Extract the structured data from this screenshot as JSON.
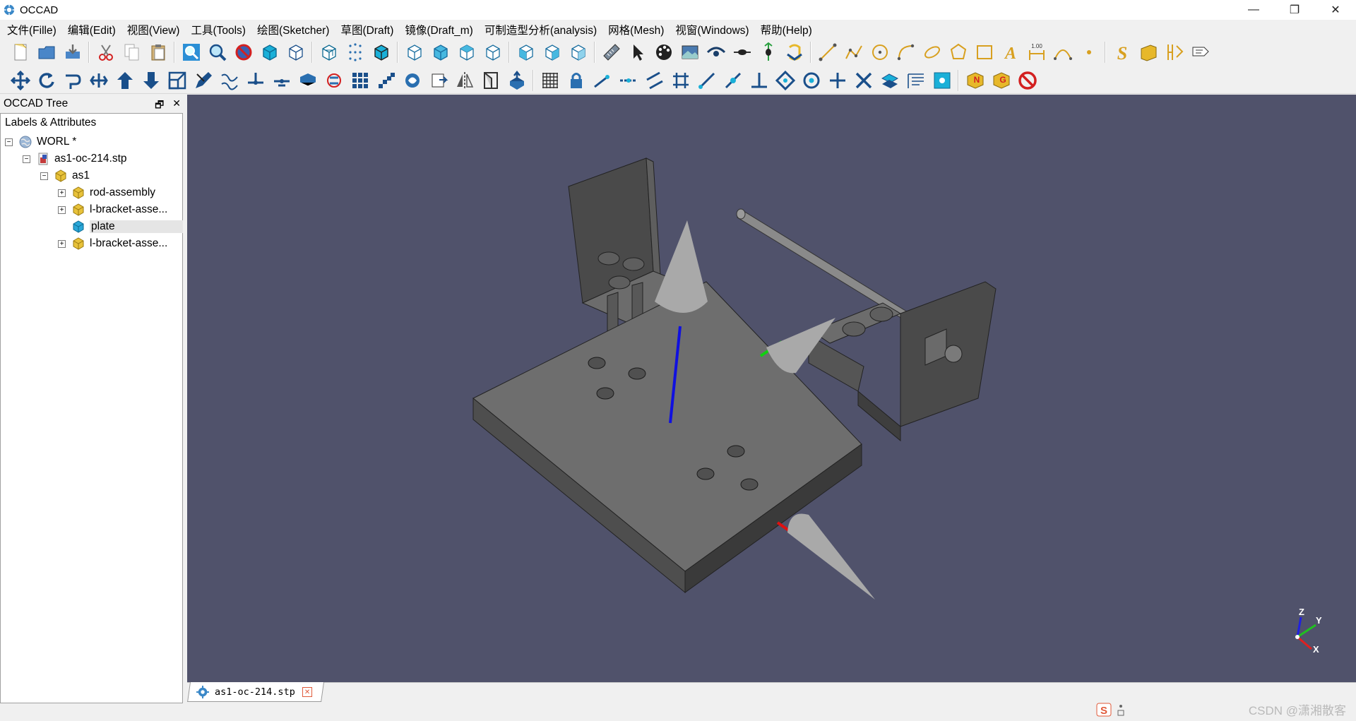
{
  "app": {
    "title": "OCCAD",
    "window_controls": [
      "—",
      "❐",
      "✕"
    ]
  },
  "menu": [
    "文件(Fille)",
    "编辑(Edit)",
    "视图(View)",
    "工具(Tools)",
    "绘图(Sketcher)",
    "草图(Draft)",
    "镜像(Draft_m)",
    "可制造型分析(analysis)",
    "网格(Mesh)",
    "视窗(Windows)",
    "帮助(Help)"
  ],
  "toolbar1_icons": [
    "new-file-icon",
    "open-folder-icon",
    "save-icon",
    "sep",
    "cut-icon",
    "copy-icon",
    "paste-icon",
    "sep",
    "zoom-fit-icon",
    "zoom-icon",
    "no-shading-icon",
    "shaded-box-icon",
    "wireframe-box-icon",
    "sep",
    "hlr-box-icon",
    "points-icon",
    "solid-box-icon",
    "sep",
    "view-front-icon",
    "view-back-icon",
    "view-top-icon",
    "view-bottom-icon",
    "sep",
    "view-left-icon",
    "view-right-icon",
    "view-iso-icon",
    "sep",
    "measure-ruler-icon",
    "select-arrow-icon",
    "color-palette-icon",
    "background-image-icon",
    "eye-icon",
    "section-icon",
    "explode-icon",
    "rotate-view-icon",
    "sep",
    "line-icon",
    "polyline-icon",
    "circle-icon",
    "arc-icon",
    "ellipse-icon",
    "polygon-icon",
    "rectangle-icon",
    "text-icon",
    "dimension-icon",
    "bezier-icon",
    "point-icon",
    "sep",
    "spline-s-icon",
    "shape-string-icon",
    "facebinder-icon",
    "label-icon"
  ],
  "toolbar2_icons": [
    "move-icon",
    "rotate-icon",
    "offset-icon",
    "trim-icon",
    "upgrade-icon",
    "downgrade-icon",
    "scale-icon",
    "edit-icon",
    "wire-to-bspline-icon",
    "add-point-icon",
    "delete-point-icon",
    "shape2dview-icon",
    "draft-to-sketch-icon",
    "array-icon",
    "path-array-icon",
    "clone-icon",
    "drawing-icon",
    "mirror-icon",
    "stretch-icon",
    "extrude-icon",
    "sep",
    "grid-icon",
    "lock-icon",
    "snap-endpoint-icon",
    "snap-midpoint-icon",
    "snap-parallel-icon",
    "snap-grid-icon",
    "snap-angle-icon",
    "snap-extension-icon",
    "snap-perpendicular-icon",
    "snap-special-icon",
    "snap-center-icon",
    "snap-ortho-icon",
    "snap-intersection-icon",
    "snap-working-plane-icon",
    "snap-dimensions-icon",
    "snap-near-icon",
    "sep",
    "cube-n-icon",
    "cube-g-icon",
    "stop-icon"
  ],
  "tree": {
    "panel_title": "OCCAD Tree",
    "column_header": "Labels & Attributes",
    "float_icon": "🗗",
    "close_icon": "✕",
    "nodes": [
      {
        "label": "WORL *",
        "icon": "globe-icon",
        "expander": "−"
      },
      {
        "label": "as1-oc-214.stp",
        "icon": "document-icon",
        "expander": "−"
      },
      {
        "label": "as1",
        "icon": "assembly-icon",
        "expander": "−"
      },
      {
        "label": "rod-assembly",
        "icon": "assembly-icon",
        "expander": "+"
      },
      {
        "label": "l-bracket-asse...",
        "icon": "assembly-icon",
        "expander": "+"
      },
      {
        "label": "plate",
        "icon": "part-icon",
        "expander": "",
        "selected": true
      },
      {
        "label": "l-bracket-asse...",
        "icon": "assembly-icon",
        "expander": "+"
      }
    ]
  },
  "viewport": {
    "background": "#50526b",
    "axis_labels": {
      "z": "Z",
      "y": "Y",
      "x": "X"
    },
    "colors": {
      "x": "#e02020",
      "y": "#20c020",
      "z": "#2020e0"
    }
  },
  "tabs": [
    {
      "label": "as1-oc-214.stp",
      "close": "✕"
    }
  ],
  "watermark": "CSDN @潇湘散客"
}
